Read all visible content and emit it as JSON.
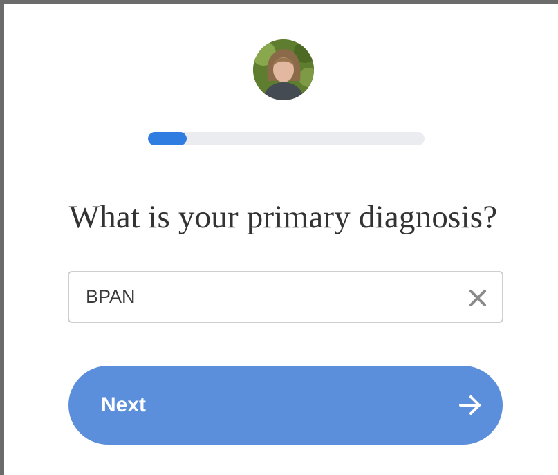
{
  "progress": {
    "fraction": 0.14,
    "fill_color": "#2f7de1",
    "track_color": "#eaecef"
  },
  "avatar": {
    "icon": "user-avatar-photo"
  },
  "question": {
    "text": "What is your primary diagnosis?"
  },
  "diagnosis_input": {
    "value": "BPAN",
    "clear_icon": "close-icon"
  },
  "next_button": {
    "label": "Next",
    "icon": "arrow-right-icon",
    "color": "#5b8fdb"
  }
}
